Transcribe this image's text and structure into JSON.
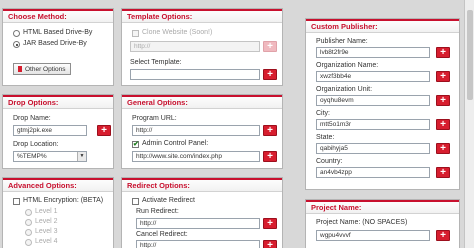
{
  "choose_method": {
    "title": "Choose Method:",
    "options": [
      "HTML Based Drive-By",
      "JAR Based Drive-By"
    ],
    "selected_index": 1,
    "other_button": "Other Options"
  },
  "template_options": {
    "title": "Template Options:",
    "clone_label": "Clone Website (Soon!)",
    "clone_value": "http://",
    "select_label": "Select Template:",
    "select_value": ""
  },
  "drop_options": {
    "title": "Drop Options:",
    "name_label": "Drop Name:",
    "name_value": "gtmj2pk.exe",
    "location_label": "Drop Location:",
    "location_value": "%TEMP%"
  },
  "general_options": {
    "title": "General Options:",
    "url_label": "Program URL:",
    "url_value": "http://",
    "admin_label": "Admin Control Panel:",
    "admin_value": "http://www.site.com/index.php"
  },
  "advanced_options": {
    "title": "Advanced Options:",
    "encryption_label": "HTML Encryption: (BETA)",
    "levels": [
      "Level 1",
      "Level 2",
      "Level 3",
      "Level 4"
    ]
  },
  "redirect_options": {
    "title": "Redirect Options:",
    "activate_label": "Activate Redirect",
    "run_label": "Run Redirect:",
    "run_value": "http://",
    "cancel_label": "Cancel Redirect:",
    "cancel_value": "http://"
  },
  "custom_publisher": {
    "title": "Custom Publisher:",
    "fields": [
      {
        "label": "Publisher Name:",
        "value": "lvb8t2fr9e"
      },
      {
        "label": "Organization Name:",
        "value": "xwzf3bb4e"
      },
      {
        "label": "Organization Unit:",
        "value": "oyqhu8evm"
      },
      {
        "label": "City:",
        "value": "mtt5o1m3r"
      },
      {
        "label": "State:",
        "value": "qabihyja5"
      },
      {
        "label": "Country:",
        "value": "an4vb4zpp"
      }
    ]
  },
  "project_name": {
    "title": "Project Name:",
    "label": "Project Name: (NO SPACES)",
    "value": "wgpu4vvvf"
  },
  "add_symbol": "+",
  "check_symbol": "✔",
  "arrow_symbol": "▼",
  "colors": {
    "accent": "#c8102e",
    "button": "#d71d2e"
  }
}
